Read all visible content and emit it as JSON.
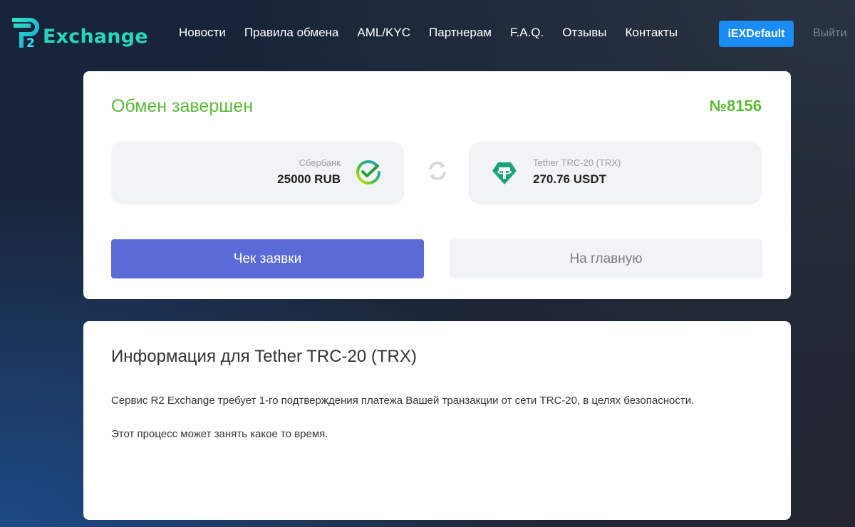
{
  "header": {
    "logo_text": "Exchange",
    "logo_mark_letters": "R2",
    "nav": [
      {
        "label": "Новости"
      },
      {
        "label": "Правила обмена"
      },
      {
        "label": "AML/KYC"
      },
      {
        "label": "Партнерам"
      },
      {
        "label": "F.A.Q."
      },
      {
        "label": "Отзывы"
      },
      {
        "label": "Контакты"
      }
    ],
    "user_button": "iEXDefault",
    "logout": "Выйти"
  },
  "status_card": {
    "title": "Обмен завершен",
    "order_number": "№8156",
    "from": {
      "label": "Сбербанк",
      "amount": "25000 RUB",
      "icon": "sberbank-icon"
    },
    "to": {
      "label": "Tether TRC-20 (TRX)",
      "amount": "270.76 USDT",
      "icon": "tether-icon"
    },
    "swap_icon": "swap-icon",
    "check_button": "Чек заявки",
    "home_button": "На главную"
  },
  "info_card": {
    "title": "Информация для Tether TRC-20 (TRX)",
    "paragraph_1": "Сервис R2 Exchange требует 1-го подтверждения платежа Вашей транзакции от сети TRC-20, в целях безопасности.",
    "paragraph_2": "Этот процесс может занять какое то время."
  },
  "colors": {
    "accent_green": "#5cbb36",
    "primary_button": "#5a6ad6",
    "user_button": "#1a8cf5",
    "logo": "#29d5b9",
    "tether": "#1ba27a"
  }
}
